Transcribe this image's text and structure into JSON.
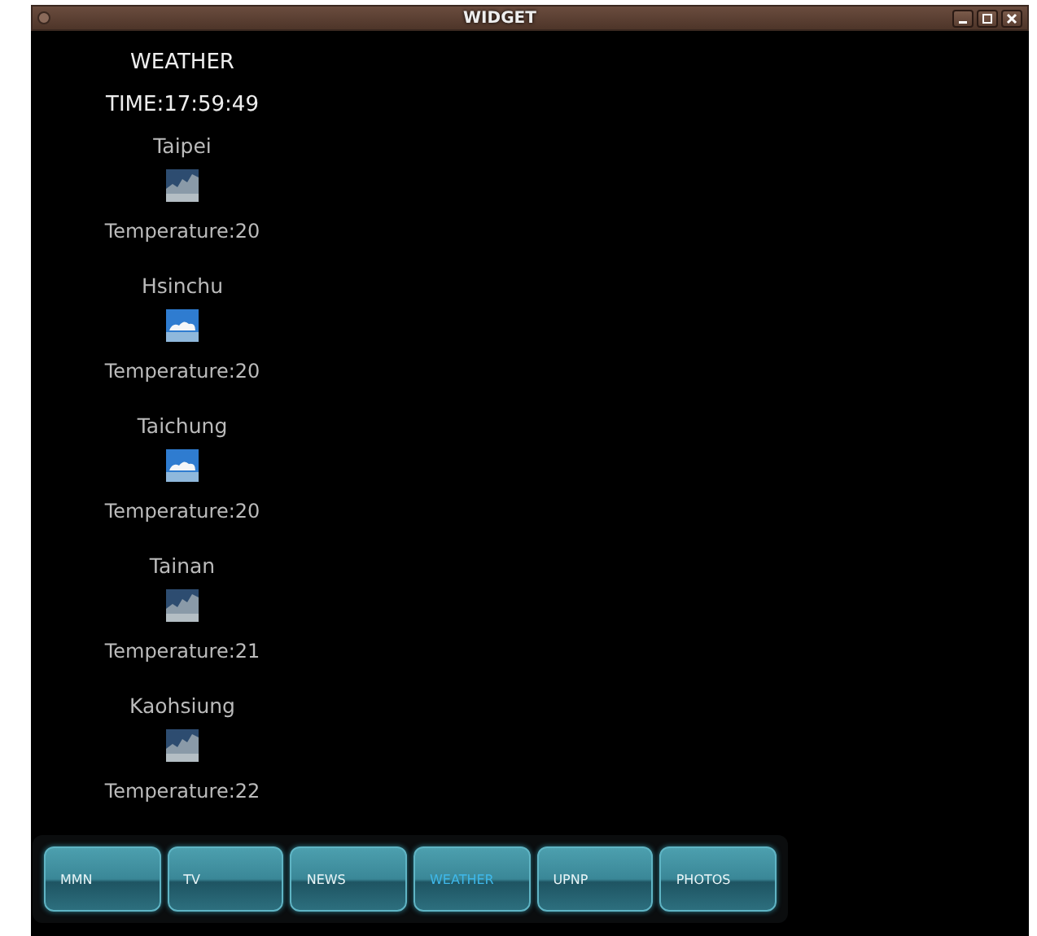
{
  "window": {
    "title": "WIDGET"
  },
  "heading": "WEATHER",
  "time": "TIME:17:59:49",
  "cities": [
    {
      "name": "Taipei",
      "kind": "cloudy",
      "temperature": "Temperature:20"
    },
    {
      "name": "Hsinchu",
      "kind": "partly-cloudy",
      "temperature": "Temperature:20"
    },
    {
      "name": "Taichung",
      "kind": "partly-cloudy",
      "temperature": "Temperature:20"
    },
    {
      "name": "Tainan",
      "kind": "cloudy",
      "temperature": "Temperature:21"
    },
    {
      "name": "Kaohsiung",
      "kind": "cloudy",
      "temperature": "Temperature:22"
    }
  ],
  "nav": [
    {
      "label": "MMN",
      "selected": false
    },
    {
      "label": "TV",
      "selected": false
    },
    {
      "label": "NEWS",
      "selected": false
    },
    {
      "label": "WEATHER",
      "selected": true
    },
    {
      "label": "UPNP",
      "selected": false
    },
    {
      "label": "PHOTOS",
      "selected": false
    }
  ]
}
